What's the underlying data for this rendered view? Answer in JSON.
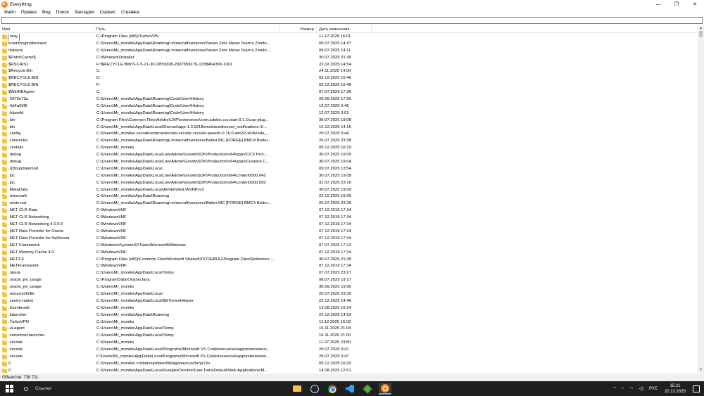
{
  "window": {
    "title": "Everything",
    "minimize": "—",
    "maximize": "❐",
    "close": "✕"
  },
  "menu": [
    "Файл",
    "Правка",
    "Вид",
    "Поиск",
    "Закладки",
    "Сервис",
    "Справка"
  ],
  "search": {
    "value": "",
    "placeholder": ""
  },
  "columns": {
    "name": "Имя",
    "path": "Путь",
    "size": "Размер",
    "date": "Дата изменения"
  },
  "rows": [
    {
      "name": "xray",
      "path": "C:\\Program Files (x86)\\TurboVPN",
      "size": "",
      "date": "11.12.2025 16:01",
      "selected": true
    },
    {
      "name": "inventoryprofilesnext",
      "path": "C:\\Users\\Mr_moniks\\AppData\\Roaming\\.minecraft\\versions\\Seven Zero Meow Team's Zombi...",
      "size": "",
      "date": "09.07.2025 14:47"
    },
    {
      "name": "Impacts",
      "path": "C:\\Users\\Mr_moniks\\AppData\\Roaming\\.minecraft\\versions\\Seven Zero Meow Team's Zombi...",
      "size": "",
      "date": "09.07.2025 14:11"
    },
    {
      "name": "$PatchCache$",
      "path": "C:\\Windows\\Installer",
      "size": "",
      "date": "30.07.2025 21:36"
    },
    {
      "name": "$RSCAIS1",
      "path": "F:\\$RECYCLE.BIN\\S-1-5-21-3612859338-2007358176-1338464390-1001",
      "size": "",
      "date": "22.02.2025 14:54"
    },
    {
      "name": "$Recycle.Bin",
      "path": "C:",
      "size": "",
      "date": "24.11.2025 14:00"
    },
    {
      "name": "$RECYCLE.BIN",
      "path": "D:",
      "size": "",
      "date": "03.12.2025 16:46"
    },
    {
      "name": "$RECYCLE.BIN",
      "path": "F:",
      "size": "",
      "date": "03.12.2025 16:46"
    },
    {
      "name": "$WinREAgent",
      "path": "C:",
      "size": "",
      "date": "07.07.2025 17:36"
    },
    {
      "name": "-2972e73a",
      "path": "C:\\Users\\Mr_moniks\\AppData\\Roaming\\Code\\User\\History",
      "size": "",
      "date": "28.09.2025 17:55"
    },
    {
      "name": "-6d4a09f9",
      "path": "C:\\Users\\Mr_moniks\\AppData\\Roaming\\Code\\User\\History",
      "size": "",
      "date": "12.07.2025 0:46"
    },
    {
      "name": "-fcbeefd",
      "path": "C:\\Users\\Mr_moniks\\AppData\\Roaming\\Code\\User\\History",
      "size": "",
      "date": "12.07.2025 0:01"
    },
    {
      "name": ".bin",
      "path": "C:\\Program Files\\Common Files\\Adobe\\UXP\\extensions\\com.adobe.ccx.start-9.1.1\\uxp-plug...",
      "size": "",
      "date": "30.07.2025 19:08"
    },
    {
      "name": ".bin",
      "path": "C:\\Users\\Mr_moniks\\AppData\\Local\\Discord\\app-1.0.9218\\modules\\discord_notifications-1\\...",
      "size": "",
      "date": "10.12.2025 14:15"
    },
    {
      "name": ".config",
      "path": "C:\\Users\\Mr_moniks\\.vscode\\extensions\\ms-vscode.vscode-speech-0.16.0-win32-x64\\node_...",
      "size": "",
      "date": "29.07.2025 0:44"
    },
    {
      "name": ".connector",
      "path": "C:\\Users\\Mr_moniks\\AppData\\Roaming\\.minecraft\\versions\\Better MC [FORGE] BMC4 Better...",
      "size": "",
      "date": "26.07.2025 23:38"
    },
    {
      "name": ".cristalix",
      "path": "C:\\Users\\Mr_moniks",
      "size": "",
      "date": "09.12.2025 16:19"
    },
    {
      "name": ".debug",
      "path": "C:\\Users\\Mr_moniks\\AppData\\LocalLow\\Adobe\\GrowthSDK\\Production\\x64\\apps\\CCX Proc...",
      "size": "",
      "date": "30.07.2025 19:09"
    },
    {
      "name": ".debug",
      "path": "C:\\Users\\Mr_moniks\\AppData\\LocalLow\\Adobe\\GrowthSDK\\Production\\x64\\apps\\Creative C...",
      "size": "",
      "date": "30.07.2025 19:04"
    },
    {
      "name": ".i18nupdatemod",
      "path": "C:\\Users\\Mr_moniks\\AppData\\Local",
      "size": "",
      "date": "09.07.2025 13:54"
    },
    {
      "name": ".ipc",
      "path": "C:\\Users\\Mr_moniks\\AppData\\LocalLow\\Adobe\\GrowthSDK\\Production\\x64\\content\\000.042",
      "size": "",
      "date": "30.07.2025 19:09"
    },
    {
      "name": ".ipc",
      "path": "C:\\Users\\Mr_moniks\\AppData\\LocalLow\\Adobe\\GrowthSDK\\Production\\x64\\content\\000.050",
      "size": "",
      "date": "31.07.2025 23:16"
    },
    {
      "name": ".MetaData",
      "path": "C:\\Users\\Mr_moniks\\AppData\\Local\\Adobe\\NGL\\ASNPsv2",
      "size": "",
      "date": "30.07.2025 19:09"
    },
    {
      "name": ".minecraft",
      "path": "C:\\Users\\Mr_moniks\\AppData\\Roaming",
      "size": "",
      "date": "22.12.2025 15:06"
    },
    {
      "name": ".mixin.out",
      "path": "C:\\Users\\Mr_moniks\\AppData\\Roaming\\.minecraft\\versions\\Better MC [FORGE] BMC4 Better...",
      "size": "",
      "date": "26.07.2025 23:39"
    },
    {
      "name": ".NET CLR Data",
      "path": "C:\\Windows\\INF",
      "size": "",
      "date": "07.12.2019 17:34"
    },
    {
      "name": ".NET CLR Networking",
      "path": "C:\\Windows\\INF",
      "size": "",
      "date": "07.12.2019 17:34"
    },
    {
      "name": ".NET CLR Networking 4.0.0.0",
      "path": "C:\\Windows\\INF",
      "size": "",
      "date": "07.12.2019 17:34"
    },
    {
      "name": ".NET Data Provider for Oracle",
      "path": "C:\\Windows\\INF",
      "size": "",
      "date": "07.12.2019 17:34"
    },
    {
      "name": ".NET Data Provider for SqlServer",
      "path": "C:\\Windows\\INF",
      "size": "",
      "date": "07.12.2019 17:34"
    },
    {
      "name": ".NET Framework",
      "path": "C:\\Windows\\System32\\Tasks\\Microsoft\\Windows",
      "size": "",
      "date": "07.07.2025 17:23"
    },
    {
      "name": ".NET Memory Cache 4.0",
      "path": "C:\\Windows\\INF",
      "size": "",
      "date": "07.12.2019 17:34"
    },
    {
      "name": ".NET2.0",
      "path": "C:\\Program Files (x86)\\Common Files\\Microsoft Shared\\VS7DEBUG\\Program Files\\Reference ...",
      "size": "",
      "date": "30.07.2025 21:35"
    },
    {
      "name": ".NETFramework",
      "path": "C:\\Windows\\INF",
      "size": "",
      "date": "07.12.2019 17:34"
    },
    {
      "name": ".opera",
      "path": "C:\\Users\\Mr_moniks\\AppData\\Local\\Temp",
      "size": "",
      "date": "07.07.2025 23:27"
    },
    {
      "name": ".oracle_jre_usage",
      "path": "C:\\ProgramData\\Oracle\\Java",
      "size": "",
      "date": "08.07.2025 19:17"
    },
    {
      "name": ".oracle_jre_usage",
      "path": "C:\\Users\\Mr_moniks",
      "size": "",
      "date": "30.09.2025 19:50"
    },
    {
      "name": ".resourcefullib",
      "path": "C:\\Users\\Mr_moniks\\AppData\\Local",
      "size": "",
      "date": "26.07.2025 23:39"
    },
    {
      "name": ".sentry-native",
      "path": "C:\\Users\\Mr_moniks\\AppData\\Local\\BitTorrentHelper",
      "size": "",
      "date": "22.12.2025 14:46"
    },
    {
      "name": ".thumbnails",
      "path": "C:\\Users\\Mr_moniks",
      "size": "",
      "date": "13.08.2025 15:14"
    },
    {
      "name": ".tlauncher",
      "path": "C:\\Users\\Mr_moniks\\AppData\\Roaming",
      "size": "",
      "date": "22.12.2025 14:52"
    },
    {
      "name": ".TurboVPN",
      "path": "C:\\Users\\Mr_moniks",
      "size": "",
      "date": "11.12.2025 16:02"
    },
    {
      "name": ".ui-agent",
      "path": "C:\\Users\\Mr_moniks\\AppData\\Local\\Temp",
      "size": "",
      "date": "16.11.2025 21:03"
    },
    {
      "name": ".voicemod-launcher",
      "path": "C:\\Users\\Mr_moniks\\AppData\\Local\\Temp",
      "size": "",
      "date": "16.11.2025 21:00"
    },
    {
      "name": ".vscode",
      "path": "C:\\Users\\Mr_moniks",
      "size": "",
      "date": "11.07.2025 23:50"
    },
    {
      "name": ".vscode",
      "path": "C:\\Users\\Mr_moniks\\AppData\\Local\\Programs\\Microsoft VS Code\\resources\\app\\extensions\\...",
      "size": "",
      "date": "29.07.2025 0:47"
    },
    {
      "name": ".vscode",
      "path": "F:\\Users\\Mr_moniks\\AppData\\Local\\Programs\\Microsoft VS Code\\resources\\app\\extensions\\...",
      "size": "",
      "date": "29.07.2025 0:47"
    },
    {
      "name": "0",
      "path": "C:\\Users\\Mr_moniks\\.cristalix\\updates\\Minigames\\cache\\p13n",
      "size": "",
      "date": "09.12.2025 16:32"
    },
    {
      "name": "0",
      "path": "C:\\Users\\Mr_moniks\\AppData\\Local\\Google\\Chrome\\User Data\\Default\\Web Applications\\M...",
      "size": "",
      "date": "14.08.2025 12:51"
    }
  ],
  "status": {
    "objects": "Объектов: 738 711"
  },
  "taskbar": {
    "search_label": "Ссылки",
    "apps": [
      "file-explorer",
      "steam",
      "chrome",
      "vscode",
      "minecraft",
      "everything"
    ],
    "tray": {
      "lang": "РУС",
      "time": "15:21",
      "date": "22.12.2025",
      "chevron": "^"
    }
  }
}
